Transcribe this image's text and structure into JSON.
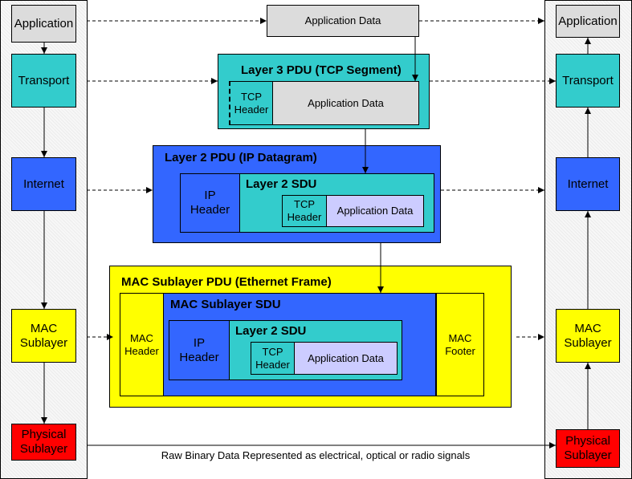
{
  "left_stack": {
    "application": "Application",
    "transport": "Transport",
    "internet": "Internet",
    "mac": "MAC Sublayer",
    "physical": "Physical Sublayer"
  },
  "right_stack": {
    "application": "Application",
    "transport": "Transport",
    "internet": "Internet",
    "mac": "MAC Sublayer",
    "physical": "Physical Sublayer"
  },
  "application_data": "Application Data",
  "layer3": {
    "title": "Layer 3 PDU (TCP Segment)",
    "tcp_header": "TCP Header",
    "app_data": "Application Data"
  },
  "layer2": {
    "title": "Layer 2 PDU (IP Datagram)",
    "ip_header": "IP Header",
    "sdu_title": "Layer 2 SDU",
    "tcp_header": "TCP Header",
    "app_data": "Application Data"
  },
  "mac_frame": {
    "title": "MAC Sublayer PDU (Ethernet Frame)",
    "mac_header": "MAC Header",
    "sdu_title": "MAC Sublayer SDU",
    "ip_header": "IP Header",
    "l2_sdu_title": "Layer 2 SDU",
    "tcp_header": "TCP Header",
    "app_data": "Application Data",
    "mac_footer": "MAC Footer"
  },
  "raw_caption": "Raw Binary Data Represented as electrical, optical or radio signals",
  "colors": {
    "application": "#dcdcdc",
    "transport": "#33cccc",
    "internet": "#3366ff",
    "mac": "#ffff00",
    "physical": "#ff0000",
    "app_data": "#ccccff"
  }
}
